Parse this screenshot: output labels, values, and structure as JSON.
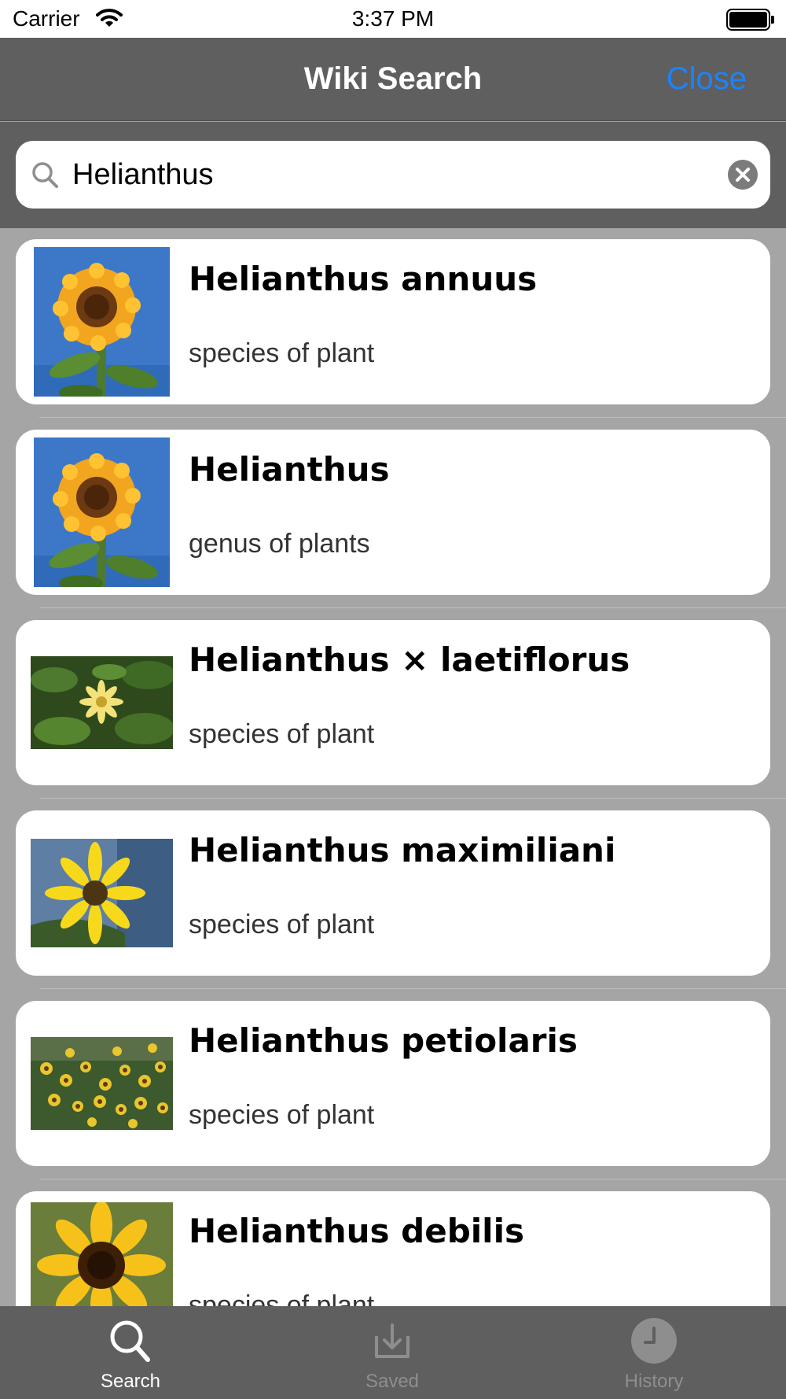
{
  "status_bar": {
    "carrier": "Carrier",
    "time": "3:37 PM"
  },
  "nav": {
    "title": "Wiki Search",
    "close_label": "Close",
    "accent_color": "#1a84ff"
  },
  "search": {
    "value": "Helianthus",
    "placeholder": ""
  },
  "results": [
    {
      "title": "Helianthus annuus",
      "description": "species of plant",
      "thumbnail": "sunflower-blue-sky"
    },
    {
      "title": "Helianthus",
      "description": "genus of plants",
      "thumbnail": "sunflower-blue-sky"
    },
    {
      "title": "Helianthus × laetiflorus",
      "description": "species of plant",
      "thumbnail": "yellow-flower-green-leaves"
    },
    {
      "title": "Helianthus maximiliani",
      "description": "species of plant",
      "thumbnail": "yellow-flower-blue"
    },
    {
      "title": "Helianthus petiolaris",
      "description": "species of plant",
      "thumbnail": "field-of-small-sunflowers"
    },
    {
      "title": "Helianthus debilis",
      "description": "species of plant",
      "thumbnail": "sunflower-closeup"
    }
  ],
  "tabs": [
    {
      "label": "Search",
      "icon": "search-icon",
      "active": true
    },
    {
      "label": "Saved",
      "icon": "download-tray-icon",
      "active": false
    },
    {
      "label": "History",
      "icon": "clock-icon",
      "active": false
    }
  ]
}
